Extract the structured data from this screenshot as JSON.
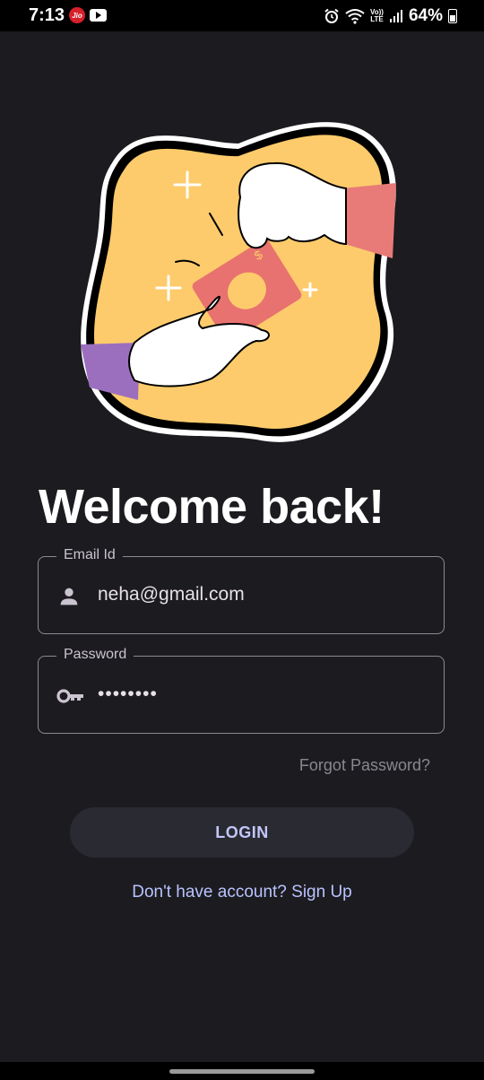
{
  "status_bar": {
    "time": "7:13",
    "carrier_badge": "Jio",
    "volte_top": "Vo))",
    "volte_bottom": "LTE",
    "battery_percent": "64%",
    "icons": [
      "jio-icon",
      "youtube-icon",
      "alarm-icon",
      "wifi-icon",
      "volte-icon",
      "signal-icon",
      "battery-icon"
    ]
  },
  "login": {
    "title": "Welcome back!",
    "email": {
      "label": "Email Id",
      "value": "neha@gmail.com",
      "icon": "person-icon"
    },
    "password": {
      "label": "Password",
      "value": "••••••••",
      "icon": "key-icon"
    },
    "forgot_password": "Forgot Password?",
    "login_button": "LOGIN",
    "signup_link": "Don't have account? Sign Up"
  },
  "colors": {
    "background": "#1c1b1f",
    "blob": "#fdcb6b",
    "money": "#e8726f",
    "sleeve_right": "#e87b78",
    "sleeve_left": "#9c6fbe",
    "link": "#b8c3ff",
    "button_text": "#c3c6f8"
  }
}
